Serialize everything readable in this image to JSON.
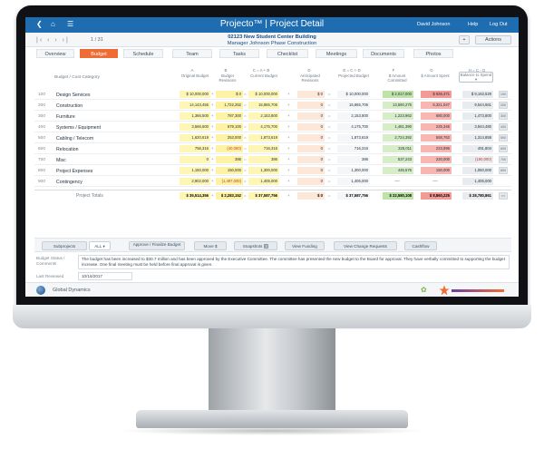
{
  "app": {
    "title": "Projecto™ | Project Detail",
    "user": "David Johnson",
    "help": "Help",
    "logout": "Log Out"
  },
  "header": {
    "pager": "1 / 31",
    "project_line": "02123   New Student Center Building",
    "manager_line": "Manager Johnson    Phase Construction",
    "actions_label": "Actions",
    "plus_label": "+"
  },
  "tabs": [
    "Overview",
    "Budget",
    "Schedule",
    "Team",
    "Tasks",
    "Checklist",
    "Meetings",
    "Documents",
    "Photos"
  ],
  "active_tab": "Budget",
  "columns": {
    "letters": [
      "A",
      "B",
      "C = A + B",
      "D",
      "E = C + D",
      "F",
      "G",
      "H = C - G"
    ],
    "category": "Budget / Cost Category",
    "original": "Original Budget",
    "revisions": "Budget Revisions",
    "current": "Current Budget",
    "anticipated": "Anticipated Revisions",
    "projected": "Projected Budget",
    "committed": "$ Amount Committed",
    "spent": "$ Amount Spent",
    "balance": "Balance to Spend"
  },
  "rows": [
    {
      "code": "100",
      "name": "Design Services",
      "a": "$ 10,000,000",
      "b": "$ 0",
      "c": "$ 10,000,000",
      "d": "$ 0",
      "e": "$ 10,000,000",
      "f": "$ 2,017,000",
      "g": "$ 836,471",
      "h": "$ 9,163,529"
    },
    {
      "code": "200",
      "name": "Construction",
      "a": "14,143,455",
      "b": "1,722,252",
      "c": "15,865,706",
      "d": "0",
      "e": "15,865,706",
      "f": "13,590,275",
      "g": "6,321,047",
      "h": "9,544,661"
    },
    {
      "code": "300",
      "name": "Furniture",
      "a": "1,366,500",
      "b": "787,300",
      "c": "2,153,800",
      "d": "0",
      "e": "2,153,800",
      "f": "1,223,962",
      "g": "680,000",
      "h": "1,473,800"
    },
    {
      "code": "400",
      "name": "Systems / Equipment",
      "a": "3,566,600",
      "b": "679,100",
      "c": "4,175,700",
      "d": "0",
      "e": "4,175,700",
      "f": "1,481,390",
      "g": "225,346",
      "h": "3,944,480"
    },
    {
      "code": "500",
      "name": "Cabling / Telecom",
      "a": "1,620,619",
      "b": "253,000",
      "c": "1,873,619",
      "d": "0",
      "e": "1,873,619",
      "f": "2,724,392",
      "g": "558,762",
      "h": "1,314,858"
    },
    {
      "code": "600",
      "name": "Relocation",
      "a": "756,316",
      "b": "(40,000)",
      "c": "716,316",
      "d": "0",
      "e": "716,316",
      "f": "325,011",
      "g": "223,896",
      "h": "491,804"
    },
    {
      "code": "700",
      "name": "Misc",
      "a": "0",
      "b": "386",
      "c": "386",
      "d": "0",
      "e": "386",
      "f": "537,243",
      "g": "220,000",
      "h": "(190,000)"
    },
    {
      "code": "800",
      "name": "Project Expenses",
      "a": "1,150,000",
      "b": "150,000",
      "c": "1,300,000",
      "d": "0",
      "e": "1,300,000",
      "f": "445,576",
      "g": "150,000",
      "h": "1,050,000"
    },
    {
      "code": "900",
      "name": "Contingency",
      "a": "2,902,000",
      "b": "(1,497,000)",
      "c": "1,405,000",
      "d": "0",
      "e": "1,405,000",
      "f": "----",
      "g": "----",
      "h": "1,405,000"
    }
  ],
  "totals": {
    "label": "Project Totals",
    "a": "$ 35,514,356",
    "b": "$ 2,283,152",
    "c": "$ 37,587,756",
    "d": "$ 0",
    "e": "$ 37,587,756",
    "f": "$ 22,580,108",
    "g": "$ 8,860,225",
    "h": "$ 28,780,861"
  },
  "actions": {
    "subprojects": "Subprojects",
    "all": "ALL",
    "approve": "Approve / Finalize Budget",
    "move": "Move $",
    "snapshots": "Snapshots",
    "snapshots_count": "3",
    "view_funding": "View Funding",
    "view_change": "View Change Requests",
    "cashflow": "Cashflow"
  },
  "status": {
    "label": "Budget Status / Comments",
    "text": "The budget has been increased to $30.7 million and has been approved by the Executive Committee. The committee has presented the new budget to the Board for approval. They have verbally committed to supporting the budget increase. One final meeting must be held before final approval is given.",
    "reviewed_label": "Last Reviewed",
    "reviewed_value": "10/16/2017"
  },
  "footer": {
    "company": "Global Dynamics"
  },
  "colors": {
    "primary": "#1f6db1",
    "accent": "#ef6c35",
    "yellow": "#fdf6b5",
    "green": "#d6edc8",
    "red": "#f7b6b2"
  }
}
